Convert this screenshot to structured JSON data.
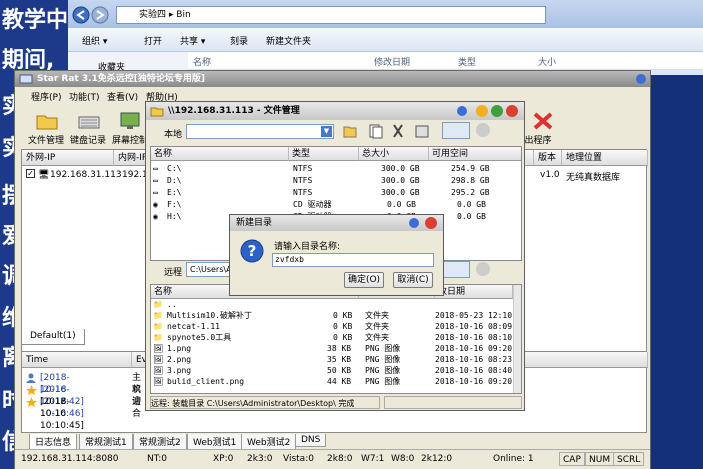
{
  "bg_chars": [
    "教学中",
    "期间,",
    "实",
    "实",
    "摆",
    "爱",
    "调",
    "维",
    "离",
    "时",
    "信"
  ],
  "explorer": {
    "path": [
      "实验四",
      "Bin"
    ],
    "toolbar": [
      "组织 ▾",
      "打开",
      "共享 ▾",
      "刻录",
      "新建文件夹"
    ],
    "columns": [
      "名称",
      "修改日期",
      "类型",
      "大小"
    ],
    "sidebar_item": "收藏夹"
  },
  "main": {
    "title": "Star Rat 3.1免杀远控[独特论坛专用版]",
    "menu": [
      "程序(P)",
      "功能(T)",
      "查看(V)",
      "帮助(H)"
    ],
    "toolbar": [
      "文件管理",
      "键盘记录",
      "屏幕控制"
    ],
    "toolbar_right": "出程序",
    "columns": [
      "外网-IP",
      "内网-IP",
      "版本",
      "地理位置"
    ],
    "row": {
      "wan_ip": "192.168.31.113",
      "lan_ip": "192.16",
      "version": "v1.0",
      "location": "无纯真数据库"
    },
    "group_tab": "Default(1)",
    "log_columns": [
      "Time",
      "Eve"
    ],
    "log_rows": [
      {
        "time": "[2018-10-16 10:12:42]",
        "event": "主机"
      },
      {
        "time": "[2018-10-16 10:10:46]",
        "event": "欢迎"
      },
      {
        "time": "[2018-10-16 10:10:45]",
        "event": "请合"
      }
    ],
    "bottom_tabs": [
      "日志信息",
      "常规测试1",
      "常规测试2",
      "Web测试1",
      "Web测试2",
      "DNS"
    ],
    "status": {
      "ip": "192.168.31.114:8080",
      "nt": "NT:0",
      "xp": "XP:0",
      "k3": "2k3:0",
      "vista": "Vista:0",
      "k8": "2k8:0",
      "w7": "W7:1",
      "w8": "W8:0",
      "k12": "2k12:0",
      "online": "Online: 1",
      "caps": "CAP",
      "num": "NUM",
      "scrl": "SCRL"
    }
  },
  "file_manager": {
    "title": "\\\\192.168.31.113 - 文件管理",
    "local_label": "本地",
    "remote_label": "远程",
    "remote_path": "C:\\Users\\A",
    "drive_columns": [
      "名称",
      "类型",
      "总大小",
      "可用空间"
    ],
    "drives": [
      {
        "name": "C:\\",
        "type": "NTFS",
        "total": "300.0 GB",
        "free": "254.9 GB"
      },
      {
        "name": "D:\\",
        "type": "NTFS",
        "total": "300.0 GB",
        "free": "298.8 GB"
      },
      {
        "name": "E:\\",
        "type": "NTFS",
        "total": "300.0 GB",
        "free": "295.2 GB"
      },
      {
        "name": "F:\\",
        "type": "CD 驱动器",
        "total": "0.0 GB",
        "free": "0.0 GB"
      },
      {
        "name": "H:\\",
        "type": "CD 驱动器",
        "total": "0.0 GB",
        "free": "0.0 GB"
      }
    ],
    "file_columns": [
      "名称",
      "改日期"
    ],
    "files": [
      {
        "name": "..",
        "size": "",
        "type": "",
        "date": ""
      },
      {
        "name": "Multisim10.破解补丁",
        "size": "0 KB",
        "type": "文件夹",
        "date": "2018-05-23 12:10"
      },
      {
        "name": "netcat-1.11",
        "size": "0 KB",
        "type": "文件夹",
        "date": "2018-10-16 08:09"
      },
      {
        "name": "spynote5.0工具",
        "size": "0 KB",
        "type": "文件夹",
        "date": "2018-10-16 08:10"
      },
      {
        "name": "1.png",
        "size": "38 KB",
        "type": "PNG 图像",
        "date": "2018-10-16 09:20"
      },
      {
        "name": "2.png",
        "size": "35 KB",
        "type": "PNG 图像",
        "date": "2018-10-16 08:23"
      },
      {
        "name": "3.png",
        "size": "50 KB",
        "type": "PNG 图像",
        "date": "2018-10-16 08:40"
      },
      {
        "name": "bulid_client.png",
        "size": "44 KB",
        "type": "PNG 图像",
        "date": "2018-10-16 09:20"
      }
    ],
    "status_text": "远程: 装载目录 C:\\Users\\Administrator\\Desktop\\ 完成"
  },
  "dialog": {
    "title": "新建目录",
    "prompt": "请输入目录名称:",
    "value": "zvfdxb",
    "ok": "确定(O)",
    "cancel": "取消(C)"
  }
}
